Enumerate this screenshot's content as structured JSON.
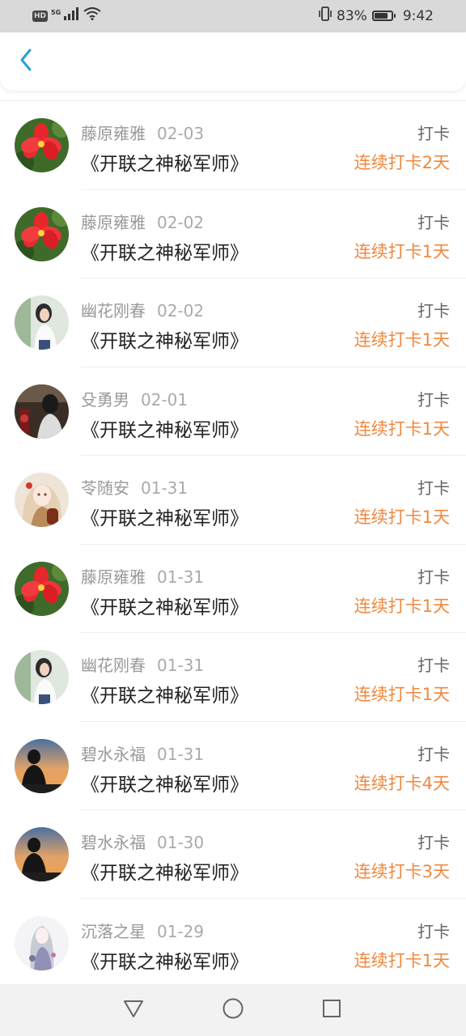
{
  "status_bar": {
    "network_badge": "HD",
    "network_type": "5G",
    "battery_percent": "83%",
    "battery_level": 0.83,
    "time": "9:42"
  },
  "header": {
    "back_icon": "chevron-left-icon",
    "accent_color": "#2a9fd8"
  },
  "colors": {
    "streak": "#f0883e",
    "name": "#999999",
    "title": "#222222"
  },
  "list": [
    {
      "name": "藤原雍雅",
      "date": "02-03",
      "title": "《开联之神秘军师》",
      "action": "打卡",
      "streak": "连续打卡2天",
      "avatar": "red-flower"
    },
    {
      "name": "藤原雍雅",
      "date": "02-02",
      "title": "《开联之神秘军师》",
      "action": "打卡",
      "streak": "连续打卡1天",
      "avatar": "red-flower"
    },
    {
      "name": "幽花刚春",
      "date": "02-02",
      "title": "《开联之神秘军师》",
      "action": "打卡",
      "streak": "连续打卡1天",
      "avatar": "girl-portrait"
    },
    {
      "name": "殳勇男",
      "date": "02-01",
      "title": "《开联之神秘军师》",
      "action": "打卡",
      "streak": "连续打卡1天",
      "avatar": "dark-scene"
    },
    {
      "name": "苓随安",
      "date": "01-31",
      "title": "《开联之神秘军师》",
      "action": "打卡",
      "streak": "连续打卡1天",
      "avatar": "anime-girl"
    },
    {
      "name": "藤原雍雅",
      "date": "01-31",
      "title": "《开联之神秘军师》",
      "action": "打卡",
      "streak": "连续打卡1天",
      "avatar": "red-flower"
    },
    {
      "name": "幽花刚春",
      "date": "01-31",
      "title": "《开联之神秘军师》",
      "action": "打卡",
      "streak": "连续打卡1天",
      "avatar": "girl-portrait"
    },
    {
      "name": "碧水永福",
      "date": "01-31",
      "title": "《开联之神秘军师》",
      "action": "打卡",
      "streak": "连续打卡4天",
      "avatar": "sunset-silhouette"
    },
    {
      "name": "碧水永福",
      "date": "01-30",
      "title": "《开联之神秘军师》",
      "action": "打卡",
      "streak": "连续打卡3天",
      "avatar": "sunset-silhouette"
    },
    {
      "name": "沉落之星",
      "date": "01-29",
      "title": "《开联之神秘军师》",
      "action": "打卡",
      "streak": "连续打卡1天",
      "avatar": "anime-figure"
    }
  ],
  "nav_bar": {
    "back_icon": "triangle-back-icon",
    "home_icon": "circle-home-icon",
    "recents_icon": "square-recents-icon"
  }
}
